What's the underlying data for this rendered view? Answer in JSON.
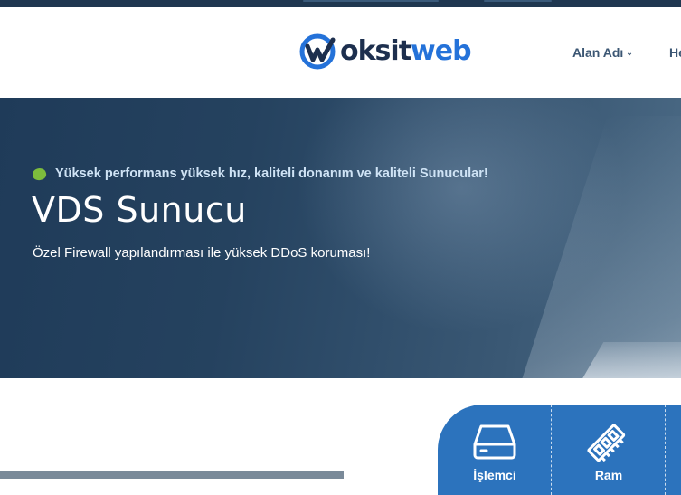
{
  "header": {
    "logo": {
      "part1": "oksit",
      "part2": "web",
      "brand_color": "#2472d9",
      "dark_color": "#1d2f4e"
    },
    "nav": [
      {
        "label": "Alan Adı",
        "has_dropdown": true
      },
      {
        "label": "He",
        "has_dropdown": false
      }
    ]
  },
  "hero": {
    "tagline": "Yüksek performans yüksek hız, kaliteli donanım ve kaliteli Sunucular!",
    "title": "VDS Sunucu",
    "subtitle": "Özel Firewall yapılandırması ile yüksek DDoS koruması!",
    "accent_color": "#7dbd3c"
  },
  "features": {
    "bg_color": "#2c73bd",
    "items": [
      {
        "label": "İşlemci",
        "icon": "hard-drive-icon"
      },
      {
        "label": "Ram",
        "icon": "ram-chip-icon"
      }
    ]
  }
}
